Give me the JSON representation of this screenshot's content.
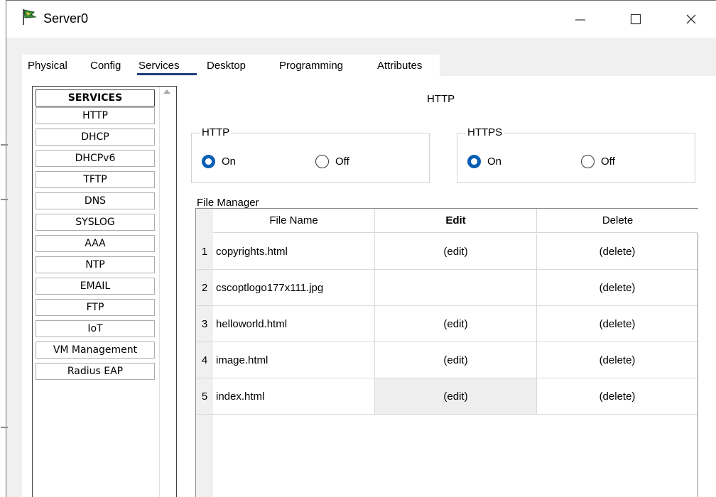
{
  "window": {
    "title": "Server0",
    "controls": {
      "minimize": "—",
      "maximize": "☐",
      "close": "✕"
    }
  },
  "tabs": [
    {
      "label": "Physical",
      "active": false
    },
    {
      "label": "Config",
      "active": false
    },
    {
      "label": "Services",
      "active": true
    },
    {
      "label": "Desktop",
      "active": false
    },
    {
      "label": "Programming",
      "active": false
    },
    {
      "label": "Attributes",
      "active": false
    }
  ],
  "services": {
    "header": "SERVICES",
    "items": [
      "HTTP",
      "DHCP",
      "DHCPv6",
      "TFTP",
      "DNS",
      "SYSLOG",
      "AAA",
      "NTP",
      "EMAIL",
      "FTP",
      "IoT",
      "VM Management",
      "Radius EAP"
    ]
  },
  "panel": {
    "heading": "HTTP",
    "http": {
      "label": "HTTP",
      "on_label": "On",
      "off_label": "Off",
      "selected": "On"
    },
    "https": {
      "label": "HTTPS",
      "on_label": "On",
      "off_label": "Off",
      "selected": "On"
    },
    "file_manager": {
      "label": "File Manager",
      "columns": [
        "File Name",
        "Edit",
        "Delete"
      ],
      "rows": [
        {
          "num": "1",
          "name": "copyrights.html",
          "edit": "(edit)",
          "delete": "(delete)"
        },
        {
          "num": "2",
          "name": "cscoptlogo177x111.jpg",
          "edit": "",
          "delete": "(delete)"
        },
        {
          "num": "3",
          "name": "helloworld.html",
          "edit": "(edit)",
          "delete": "(delete)"
        },
        {
          "num": "4",
          "name": "image.html",
          "edit": "(edit)",
          "delete": "(delete)"
        },
        {
          "num": "5",
          "name": "index.html",
          "edit": "(edit)",
          "delete": "(delete)"
        }
      ]
    }
  },
  "colors": {
    "accent": "#0a5fb4",
    "tab_underline": "#1f3d7a"
  }
}
